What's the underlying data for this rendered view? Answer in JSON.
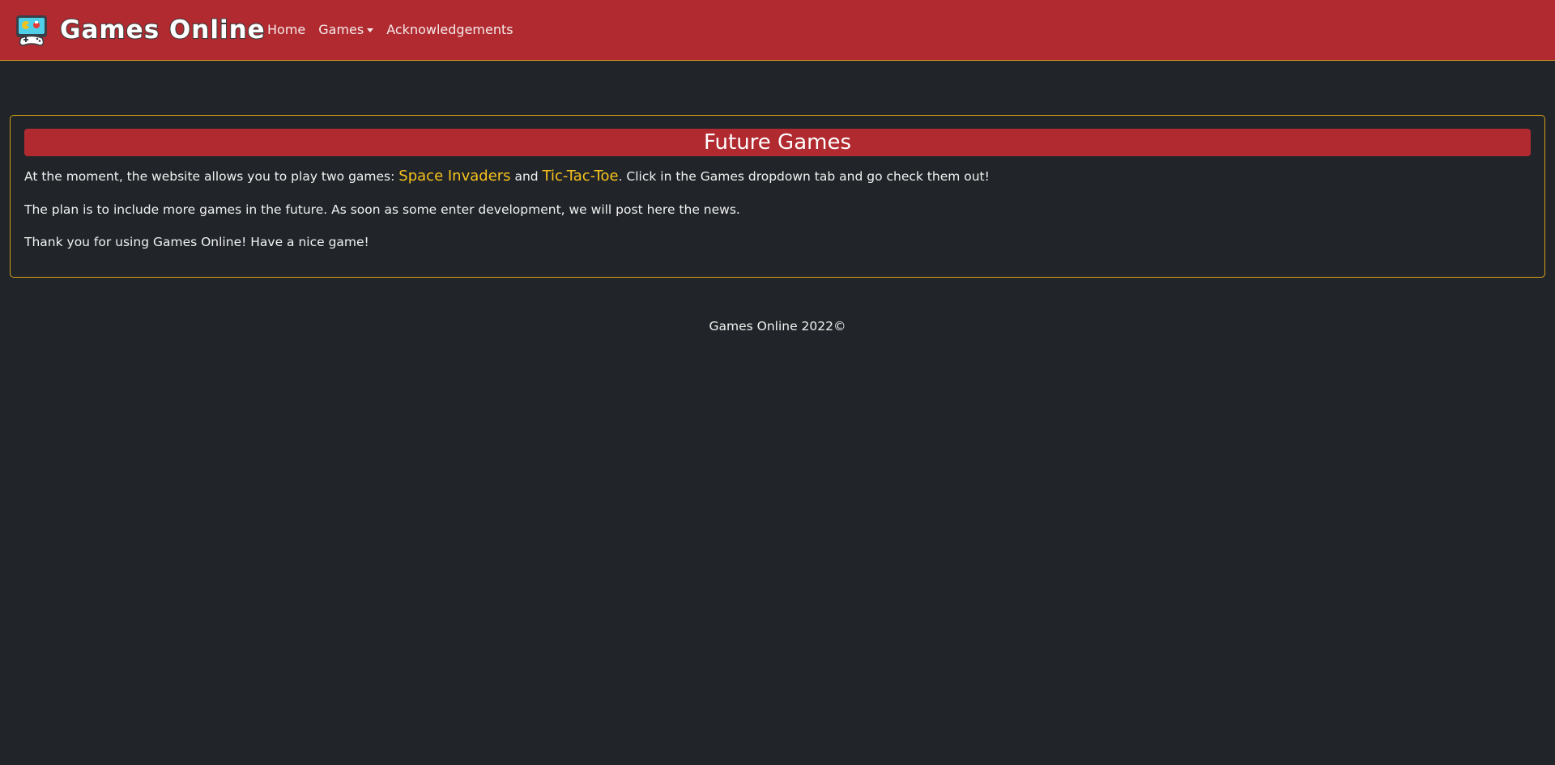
{
  "brand": {
    "name": "Games Online",
    "logo_icon": "gamepad-robot-logo-icon"
  },
  "nav": {
    "home": "Home",
    "games": "Games",
    "acknowledgements": "Acknowledgements"
  },
  "card": {
    "title": "Future Games",
    "p1_before": "At the moment, the website allows you to play two games: ",
    "link_space_invaders": "Space Invaders",
    "p1_and": " and ",
    "link_tictactoe": "Tic-Tac-Toe",
    "p1_after": ". Click in the Games dropdown tab and go check them out!",
    "p2": "The plan is to include more games in the future. As soon as some enter development, we will post here the news.",
    "p3": "Thank you for using Games Online! Have a nice game!"
  },
  "footer": {
    "text": "Games Online 2022©"
  },
  "colors": {
    "navbar": "#b02a30",
    "background": "#212529",
    "accent": "#f7c21d",
    "card_border": "#d4a017"
  }
}
